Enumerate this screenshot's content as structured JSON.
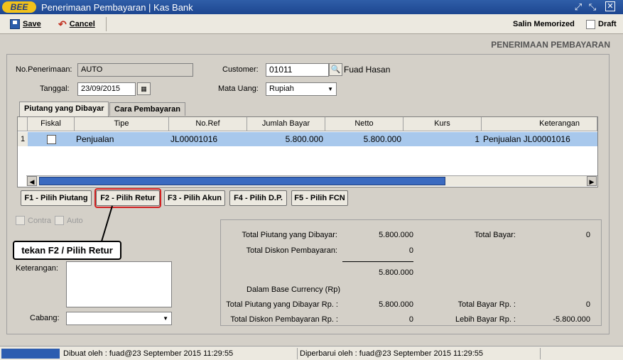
{
  "app": {
    "logo": "BEE",
    "title": "Penerimaan Pembayaran | Kas Bank"
  },
  "toolbar": {
    "save_label": "Save",
    "cancel_label": "Cancel",
    "memorized_label": "Salin Memorized",
    "draft_label": "Draft"
  },
  "header": {
    "label": "PENERIMAAN PEMBAYARAN"
  },
  "form": {
    "no_penerimaan_label": "No.Penerimaan:",
    "no_penerimaan_value": "AUTO",
    "tanggal_label": "Tanggal:",
    "tanggal_value": "23/09/2015",
    "customer_label": "Customer:",
    "customer_code": "01011",
    "customer_name": "Fuad Hasan",
    "mata_uang_label": "Mata Uang:",
    "mata_uang_value": "Rupiah"
  },
  "tabs": [
    {
      "label": "Piutang yang Dibayar"
    },
    {
      "label": "Cara Pembayaran"
    }
  ],
  "grid": {
    "columns": [
      "Fiskal",
      "Tipe",
      "No.Ref",
      "Jumlah Bayar",
      "Netto",
      "Kurs",
      "Keterangan"
    ],
    "rows": [
      {
        "no": "1",
        "tipe": "Penjualan",
        "no_ref": "JL00001016",
        "jumlah_bayar": "5.800.000",
        "netto": "5.800.000",
        "kurs": "1",
        "keterangan": "Penjualan JL00001016"
      }
    ]
  },
  "buttons": {
    "f1": "F1 - Pilih Piutang",
    "f2": "F2 - Pilih Retur",
    "f3": "F3 - Pilih Akun",
    "f4": "F4 - Pilih D.P.",
    "f5": "F5 - Pilih FCN"
  },
  "options": {
    "contra": "Contra",
    "auto": "Auto"
  },
  "callout": "tekan F2 / Pilih Retur",
  "notes": {
    "keterangan_label": "Keterangan:",
    "cabang_label": "Cabang:"
  },
  "totals": {
    "total_piutang_label": "Total Piutang yang Dibayar:",
    "total_piutang_value": "5.800.000",
    "total_diskon_label": "Total Diskon Pembayaran:",
    "total_diskon_value": "0",
    "subtotal_value": "5.800.000",
    "total_bayar_label": "Total Bayar:",
    "total_bayar_value": "0",
    "base_currency_label": "Dalam Base Currency (Rp)",
    "total_piutang_rp_label": "Total Piutang yang Dibayar Rp. :",
    "total_piutang_rp_value": "5.800.000",
    "total_diskon_rp_label": "Total Diskon Pembayaran Rp. :",
    "total_diskon_rp_value": "0",
    "total_bayar_rp_label": "Total Bayar Rp. :",
    "total_bayar_rp_value": "0",
    "lebih_bayar_rp_label": "Lebih Bayar Rp. :",
    "lebih_bayar_rp_value": "-5.800.000"
  },
  "status": {
    "created": "Dibuat oleh : fuad@23 September 2015  11:29:55",
    "updated": "Diperbarui oleh : fuad@23 September 2015  11:29:55"
  },
  "colors": {
    "title_bar": "#1d4690",
    "selected_row": "#a8c8ec",
    "highlight": "#d22020",
    "scroll_thumb": "#3a6ac0"
  }
}
